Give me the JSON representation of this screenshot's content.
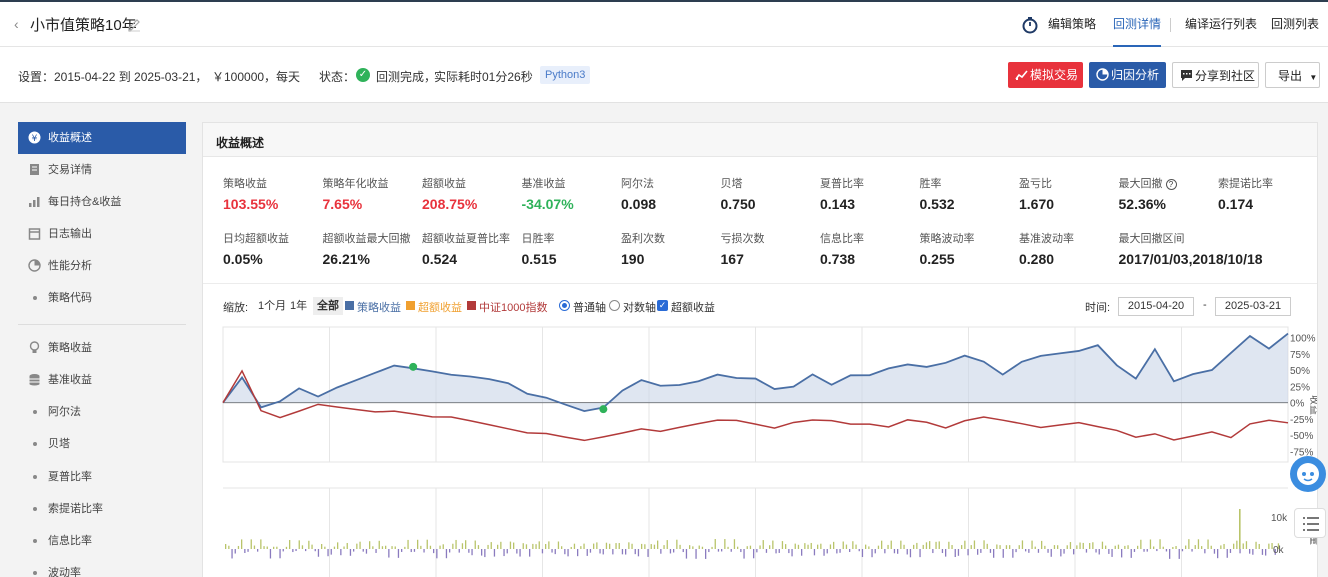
{
  "header": {
    "title": "小市值策略10年",
    "nav": [
      "编辑策略",
      "回测详情",
      "编译运行列表",
      "回测列表"
    ]
  },
  "settings": {
    "label": "设置：",
    "period": "2015-04-22 到 2025-03-21，",
    "capital": "￥100000，",
    "freq": "每天",
    "status_label": "状态：",
    "status": "回测完成，",
    "elapsed": "实际耗时01分26秒",
    "python": "Python3"
  },
  "buttons": {
    "simulate": "模拟交易",
    "attribution": "归因分析",
    "share": "分享到社区",
    "export": "导出"
  },
  "sidebar": {
    "items": [
      {
        "label": "收益概述"
      },
      {
        "label": "交易详情"
      },
      {
        "label": "每日持仓&收益"
      },
      {
        "label": "日志输出"
      },
      {
        "label": "性能分析"
      },
      {
        "label": "策略代码"
      },
      {
        "label": "策略收益"
      },
      {
        "label": "基准收益"
      },
      {
        "label": "阿尔法"
      },
      {
        "label": "贝塔"
      },
      {
        "label": "夏普比率"
      },
      {
        "label": "索提诺比率"
      },
      {
        "label": "信息比率"
      },
      {
        "label": "波动率"
      }
    ]
  },
  "panel": {
    "title": "收益概述",
    "metrics_row1": [
      {
        "label": "策略收益",
        "value": "103.55%",
        "color": "#e8323c"
      },
      {
        "label": "策略年化收益",
        "value": "7.65%",
        "color": "#e8323c"
      },
      {
        "label": "超额收益",
        "value": "208.75%",
        "color": "#e8323c"
      },
      {
        "label": "基准收益",
        "value": "-34.07%",
        "color": "#2fb25a"
      },
      {
        "label": "阿尔法",
        "value": "0.098"
      },
      {
        "label": "贝塔",
        "value": "0.750"
      },
      {
        "label": "夏普比率",
        "value": "0.143"
      },
      {
        "label": "胜率",
        "value": "0.532"
      },
      {
        "label": "盈亏比",
        "value": "1.670"
      },
      {
        "label": "最大回撤",
        "value": "52.36%"
      },
      {
        "label": "索提诺比率",
        "value": "0.174"
      }
    ],
    "metrics_row2": [
      {
        "label": "日均超额收益",
        "value": "0.05%"
      },
      {
        "label": "超额收益最大回撤",
        "value": "26.21%"
      },
      {
        "label": "超额收益夏普比率",
        "value": "0.524"
      },
      {
        "label": "日胜率",
        "value": "0.515"
      },
      {
        "label": "盈利次数",
        "value": "190"
      },
      {
        "label": "亏损次数",
        "value": "167"
      },
      {
        "label": "信息比率",
        "value": "0.738"
      },
      {
        "label": "策略波动率",
        "value": "0.255"
      },
      {
        "label": "基准波动率",
        "value": "0.280"
      },
      {
        "label": "最大回撤区间",
        "value": "2017/01/03,2018/10/18"
      }
    ]
  },
  "chart_controls": {
    "zoom_label": "缩放:",
    "zoom_options": [
      "1个月",
      "1年",
      "全部"
    ],
    "legend": [
      {
        "name": "策略收益",
        "color": "#4a6fa5"
      },
      {
        "name": "超额收益",
        "color": "#f0a030"
      },
      {
        "name": "中证1000指数",
        "color": "#b23a3a"
      }
    ],
    "axis_normal": "普通轴",
    "axis_log": "对数轴",
    "excess_toggle": "超额收益",
    "time_label": "时间:",
    "date_from": "2015-04-20",
    "date_to": "2025-03-21",
    "dash": "-",
    "yaxis_title": "收益",
    "vol_title": "量"
  },
  "chart_data": {
    "type": "line",
    "y_ticks": [
      "100%",
      "75%",
      "50%",
      "25%",
      "0%",
      "-25%",
      "-50%",
      "-75%"
    ],
    "ylim": [
      -85,
      110
    ],
    "vol_ticks": [
      "10k",
      "0k"
    ],
    "series": [
      {
        "name": "策略收益",
        "color": "#4a6fa5",
        "values": [
          0,
          40,
          -5,
          5,
          25,
          12,
          25,
          35,
          45,
          55,
          50,
          45,
          40,
          38,
          35,
          30,
          15,
          10,
          0,
          -10,
          -5,
          20,
          35,
          25,
          25,
          30,
          40,
          35,
          35,
          20,
          25,
          45,
          30,
          45,
          45,
          55,
          60,
          55,
          60,
          70,
          60,
          40,
          60,
          70,
          75,
          80,
          90,
          60,
          40,
          85,
          35,
          45,
          50,
          75,
          100,
          80,
          103
        ]
      },
      {
        "name": "中证1000指数",
        "color": "#b23a3a",
        "values": [
          0,
          50,
          -10,
          -20,
          -10,
          0,
          -5,
          -10,
          -15,
          -15,
          -20,
          -25,
          -25,
          -30,
          -35,
          -40,
          -45,
          -45,
          -50,
          -55,
          -50,
          -45,
          -40,
          -45,
          -40,
          -35,
          -30,
          -30,
          -35,
          -40,
          -30,
          -25,
          -25,
          -30,
          -30,
          -35,
          -25,
          -30,
          -40,
          -30,
          -25,
          -30,
          -35,
          -40,
          -35,
          -30,
          -35,
          -40,
          -50,
          -45,
          -55,
          -50,
          -45,
          -55,
          -35,
          -30,
          -34
        ]
      }
    ],
    "markers": [
      {
        "name": "max-drawdown-start",
        "index": 10,
        "value": 55,
        "color": "#2fb25a"
      },
      {
        "name": "max-drawdown-end",
        "index": 20,
        "value": -10,
        "color": "#2fb25a"
      }
    ]
  }
}
